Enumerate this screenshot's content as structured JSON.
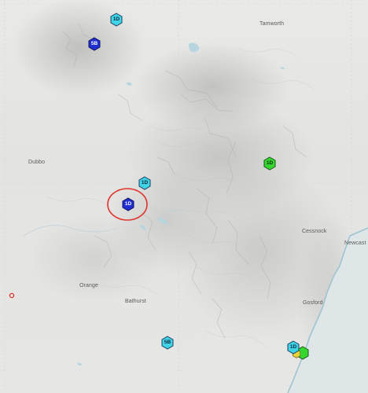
{
  "places": {
    "tamworth": "Tamworth",
    "dubbo": "Dubbo",
    "cessnock": "Cessnock",
    "newcastle": "Newcast",
    "orange": "Orange",
    "bathurst": "Bathurst",
    "gosford": "Gosford"
  },
  "markers": {
    "m1": "1D",
    "m2": "5B",
    "m3": "1D",
    "m4": "1D",
    "m5": "1D",
    "m6": "5B",
    "m7": "1D"
  },
  "colors": {
    "cyan": "#3fd3e6",
    "blue": "#1f2fd0",
    "green": "#36d630",
    "highlight": "#e0342c",
    "water": "#b7d5df",
    "coast": "#9fc3cf"
  }
}
